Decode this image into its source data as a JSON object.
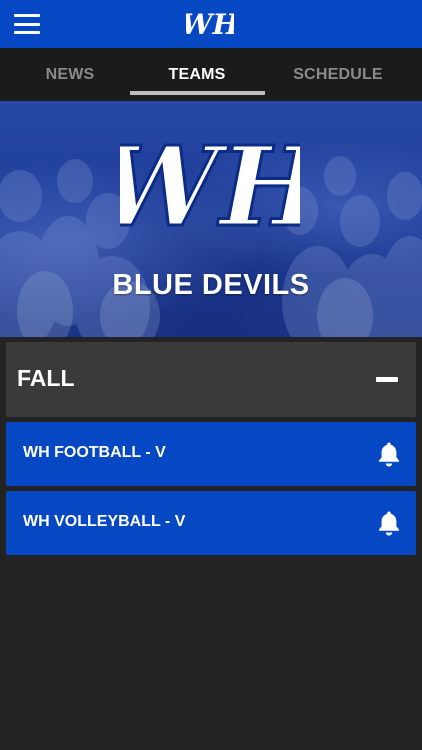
{
  "header": {
    "logo_text": "WH",
    "menu_icon": "hamburger-menu-icon",
    "color": "#0647c4"
  },
  "tabs": [
    {
      "label": "NEWS",
      "active": false
    },
    {
      "label": "TEAMS",
      "active": true
    },
    {
      "label": "SCHEDULE",
      "active": false
    }
  ],
  "hero": {
    "logo_text": "WH",
    "title": "BLUE DEVILS"
  },
  "section": {
    "title": "FALL",
    "collapse_icon": "minus-icon",
    "expanded": true
  },
  "teams": [
    {
      "name": "WH FOOTBALL - V",
      "icon": "bell-icon"
    },
    {
      "name": "WH VOLLEYBALL - V",
      "icon": "bell-icon"
    }
  ],
  "colors": {
    "accent": "#0647c4",
    "background": "#232323",
    "tab_bar": "#1b1b1b",
    "section_header": "#3a3a3a"
  }
}
